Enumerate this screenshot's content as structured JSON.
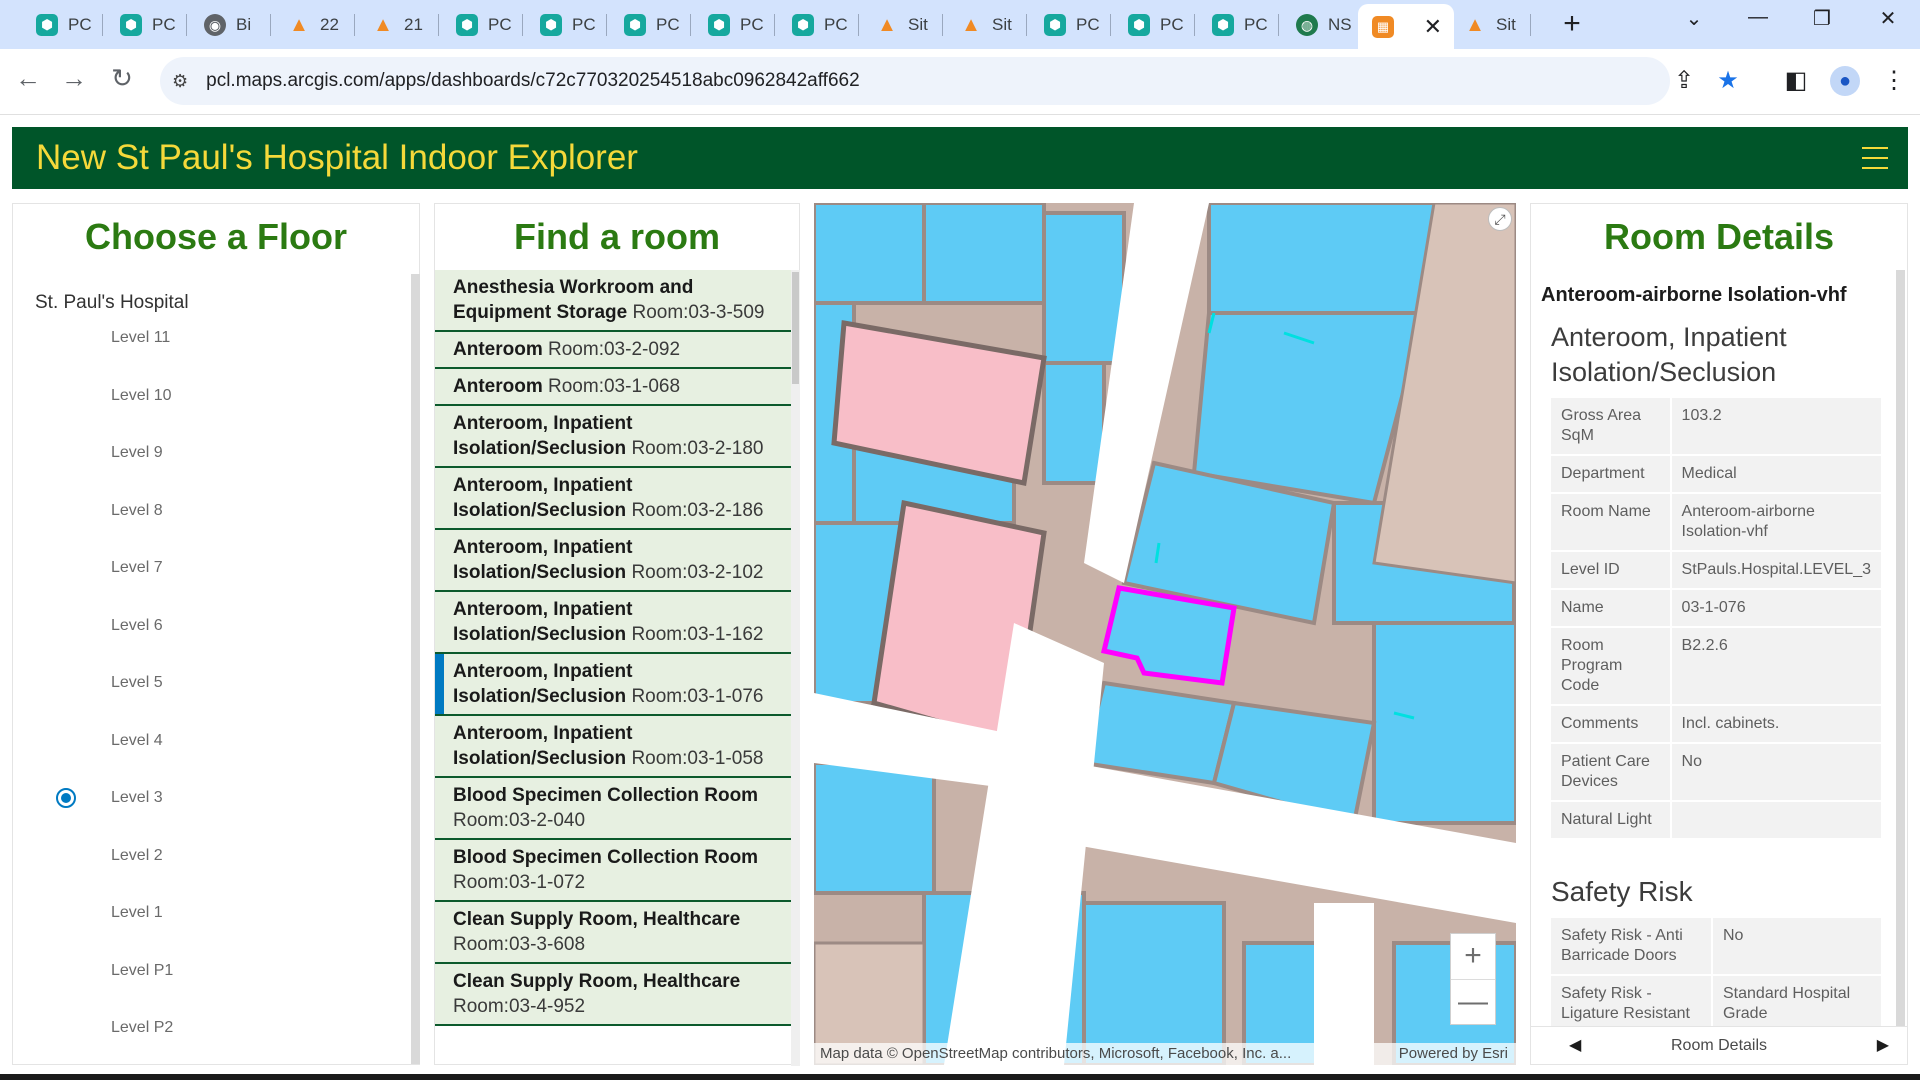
{
  "browser": {
    "tabs": [
      {
        "label": "PC",
        "icon": "hex-icon"
      },
      {
        "label": "PC",
        "icon": "hex-icon"
      },
      {
        "label": "Bi",
        "icon": "globe-icon"
      },
      {
        "label": "22",
        "icon": "arcgis-icon"
      },
      {
        "label": "21",
        "icon": "arcgis-icon"
      },
      {
        "label": "PC",
        "icon": "hex-icon"
      },
      {
        "label": "PC",
        "icon": "hex-icon"
      },
      {
        "label": "PC",
        "icon": "hex-icon"
      },
      {
        "label": "PC",
        "icon": "hex-icon"
      },
      {
        "label": "PC",
        "icon": "hex-icon"
      },
      {
        "label": "Sit",
        "icon": "arcgis-icon"
      },
      {
        "label": "Sit",
        "icon": "arcgis-icon"
      },
      {
        "label": "PC",
        "icon": "hex-icon"
      },
      {
        "label": "PC",
        "icon": "hex-icon"
      },
      {
        "label": "PC",
        "icon": "hex-icon"
      },
      {
        "label": "NS",
        "icon": "world-icon"
      },
      {
        "label": "",
        "icon": "dashboard-icon",
        "active": true
      },
      {
        "label": "Sit",
        "icon": "arcgis-icon"
      }
    ],
    "url": "pcl.maps.arcgis.com/apps/dashboards/c72c770320254518abc0962842aff662"
  },
  "app": {
    "title": "New St Paul's Hospital Indoor Explorer",
    "colors": {
      "header_bg": "#005529",
      "title_color": "#f5d93a",
      "panel_title": "#2b7a12",
      "accent": "#007ac2",
      "room_fill": "#5ecbf5",
      "highlight": "#ff00ff"
    }
  },
  "floors": {
    "title": "Choose a Floor",
    "root": "St. Paul's Hospital",
    "items": [
      "Level 11",
      "Level 10",
      "Level 9",
      "Level 8",
      "Level 7",
      "Level 6",
      "Level 5",
      "Level 4",
      "Level 3",
      "Level 2",
      "Level 1",
      "Level P1",
      "Level P2"
    ],
    "selected": "Level 3"
  },
  "rooms": {
    "title": "Find a room",
    "items": [
      {
        "name": "Anesthesia Workroom and Equipment Storage",
        "room": "Room:03-3-509"
      },
      {
        "name": "Anteroom",
        "room": "Room:03-2-092"
      },
      {
        "name": "Anteroom",
        "room": "Room:03-1-068"
      },
      {
        "name": "Anteroom, Inpatient Isolation/Seclusion",
        "room": "Room:03-2-180"
      },
      {
        "name": "Anteroom, Inpatient Isolation/Seclusion",
        "room": "Room:03-2-186"
      },
      {
        "name": "Anteroom, Inpatient Isolation/Seclusion",
        "room": "Room:03-2-102"
      },
      {
        "name": "Anteroom, Inpatient Isolation/Seclusion",
        "room": "Room:03-1-162"
      },
      {
        "name": "Anteroom, Inpatient Isolation/Seclusion",
        "room": "Room:03-1-076",
        "selected": true
      },
      {
        "name": "Anteroom, Inpatient Isolation/Seclusion",
        "room": "Room:03-1-058"
      },
      {
        "name": "Blood Specimen Collection Room",
        "room": "Room:03-2-040"
      },
      {
        "name": "Blood Specimen Collection Room",
        "room": "Room:03-1-072"
      },
      {
        "name": "Clean Supply Room, Healthcare",
        "room": "Room:03-3-608"
      },
      {
        "name": "Clean Supply Room, Healthcare",
        "room": "Room:03-4-952"
      }
    ]
  },
  "map": {
    "attribution": "Map data © OpenStreetMap contributors, Microsoft, Facebook, Inc. a...",
    "powered_by": "Powered by Esri",
    "zoom_in": "+",
    "zoom_out": "—"
  },
  "details": {
    "title": "Room Details",
    "room_heading": "Anteroom-airborne Isolation-vhf",
    "room_type": "Anteroom, Inpatient Isolation/Seclusion",
    "attributes": [
      {
        "k": "Gross Area SqM",
        "v": "103.2"
      },
      {
        "k": "Department",
        "v": "Medical"
      },
      {
        "k": "Room Name",
        "v": "Anteroom-airborne Isolation-vhf"
      },
      {
        "k": "Level ID",
        "v": "StPauls.Hospital.LEVEL_3"
      },
      {
        "k": "Name",
        "v": "03-1-076"
      },
      {
        "k": "Room Program Code",
        "v": "B2.2.6"
      },
      {
        "k": "Comments",
        "v": "Incl. cabinets."
      },
      {
        "k": "Patient Care Devices",
        "v": "No"
      },
      {
        "k": "Natural Light",
        "v": ""
      }
    ],
    "safety_title": "Safety Risk",
    "safety": [
      {
        "k": "Safety Risk - Anti Barricade Doors",
        "v": "No"
      },
      {
        "k": "Safety Risk - Ligature Resistant",
        "v": "Standard Hospital Grade"
      }
    ],
    "footer_label": "Room Details"
  }
}
